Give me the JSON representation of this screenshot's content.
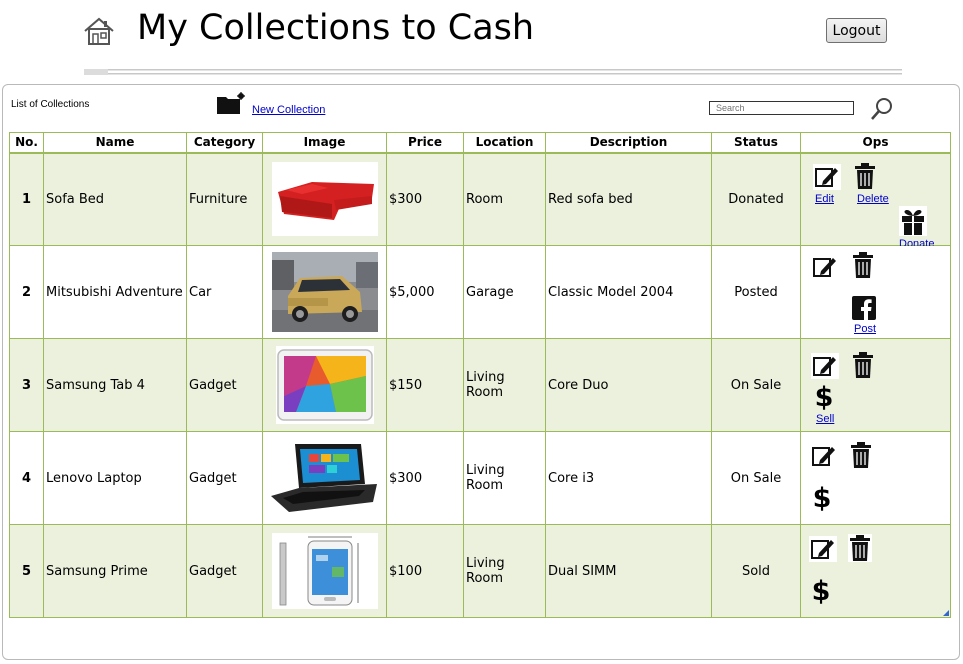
{
  "header": {
    "title": "My Collections to Cash",
    "logout_label": "Logout"
  },
  "toolbar": {
    "list_label": "List of Collections",
    "new_collection_label": "New Collection",
    "search_placeholder": "Search"
  },
  "table": {
    "columns": [
      "No.",
      "Name",
      "Category",
      "Image",
      "Price",
      "Location",
      "Description",
      "Status",
      "Ops"
    ],
    "rows": [
      {
        "no": "1",
        "name": "Sofa Bed",
        "category": "Furniture",
        "image": "red-sofa-image",
        "price": "$300",
        "location": "Room",
        "description": "Red sofa bed",
        "status": "Donated",
        "ops": {
          "edit_label": "Edit",
          "delete_label": "Delete",
          "extra_label": "Donate",
          "extra_icon": "gift-icon"
        }
      },
      {
        "no": "2",
        "name": "Mitsubishi Adventure",
        "category": "Car",
        "image": "gold-suv-image",
        "price": "$5,000",
        "location": "Garage",
        "description": "Classic Model 2004",
        "status": "Posted",
        "ops": {
          "extra_label": "Post",
          "extra_icon": "facebook-icon"
        }
      },
      {
        "no": "3",
        "name": "Samsung Tab 4",
        "category": "Gadget",
        "image": "tablet-image",
        "price": "$150",
        "location": "Living Room",
        "description": "Core Duo",
        "status": "On Sale",
        "ops": {
          "extra_label": "Sell",
          "extra_icon": "dollar-icon"
        }
      },
      {
        "no": "4",
        "name": "Lenovo Laptop",
        "category": "Gadget",
        "image": "laptop-image",
        "price": "$300",
        "location": "Living Room",
        "description": "Core i3",
        "status": "On Sale",
        "ops": {
          "extra_icon": "dollar-icon"
        }
      },
      {
        "no": "5",
        "name": "Samsung Prime",
        "category": "Gadget",
        "image": "phone-image",
        "price": "$100",
        "location": "Living Room",
        "description": "Dual SIMM",
        "status": "Sold",
        "ops": {
          "extra_icon": "dollar-icon"
        }
      }
    ]
  },
  "colors": {
    "row_alt": "#ebf1dd",
    "border": "#9bbb59",
    "link": "#0000cc"
  },
  "icons": [
    "home-icon",
    "folder-add-icon",
    "search-icon",
    "edit-icon",
    "trash-icon",
    "gift-icon",
    "facebook-icon",
    "dollar-icon"
  ]
}
